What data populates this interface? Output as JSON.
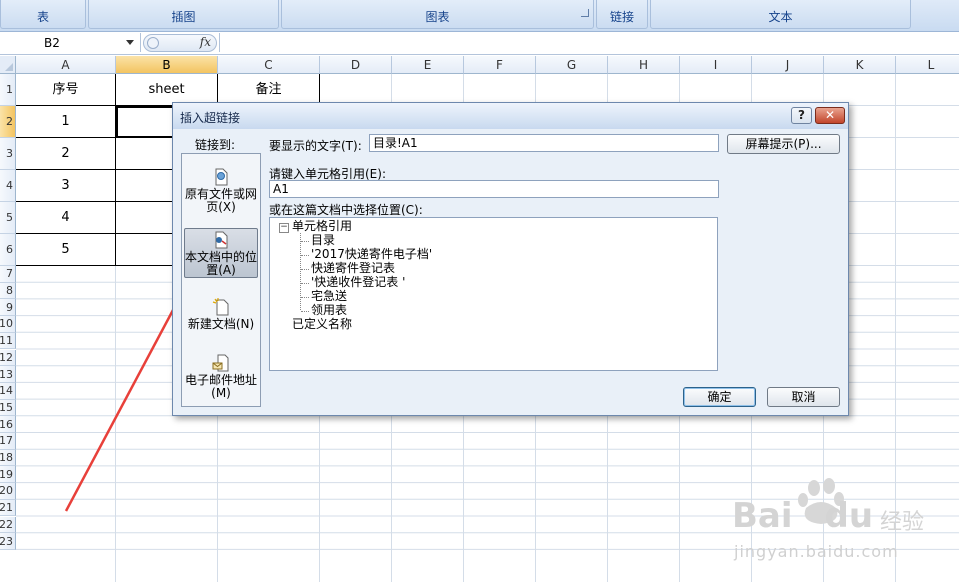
{
  "ribbon": {
    "groups": [
      "表",
      "插图",
      "图表",
      "链接",
      "文本"
    ]
  },
  "formula_bar": {
    "name_box": "B2",
    "fx_label": "fx",
    "formula": ""
  },
  "sheet": {
    "columns": [
      "A",
      "B",
      "C",
      "D",
      "E",
      "F",
      "G",
      "H",
      "I",
      "J",
      "K",
      "L"
    ],
    "selected_column": "B",
    "rows": [
      "1",
      "2",
      "3",
      "4",
      "5",
      "6",
      "7",
      "8",
      "9",
      "10",
      "11",
      "12",
      "13",
      "14",
      "15",
      "16",
      "17",
      "18",
      "19",
      "20",
      "21",
      "22",
      "23"
    ],
    "headers": [
      "序号",
      "sheet",
      "备注"
    ],
    "data_rows": [
      [
        "1",
        "",
        ""
      ],
      [
        "2",
        "",
        ""
      ],
      [
        "3",
        "",
        ""
      ],
      [
        "4",
        "",
        ""
      ],
      [
        "5",
        "",
        ""
      ]
    ]
  },
  "dialog": {
    "title": "插入超链接",
    "help_label": "?",
    "close_label": "✕",
    "link_to_label": "链接到:",
    "link_items": [
      {
        "label": "原有文件或网页(X)",
        "icon": "web-page-icon"
      },
      {
        "label": "本文档中的位置(A)",
        "icon": "document-place-icon"
      },
      {
        "label": "新建文档(N)",
        "icon": "new-document-icon"
      },
      {
        "label": "电子邮件地址(M)",
        "icon": "email-icon"
      }
    ],
    "display_text_label": "要显示的文字(T):",
    "display_text_value": "目录!A1",
    "screentip_button": "屏幕提示(P)...",
    "cell_ref_label": "请键入单元格引用(E):",
    "cell_ref_value": "A1",
    "place_label": "或在这篇文档中选择位置(C):",
    "tree": {
      "expander": "−",
      "root": "单元格引用",
      "children": [
        "目录",
        "'2017快递寄件电子档'",
        "快递寄件登记表",
        "'快递收件登记表 '",
        "宅急送",
        "领用表"
      ],
      "defined_names": "已定义名称"
    },
    "ok_button": "确定",
    "cancel_button": "取消"
  },
  "watermark": {
    "brand": "Bai",
    "brand2": "du",
    "tagline": "经验",
    "url": "jingyan.baidu.com"
  },
  "colors": {
    "arrow": "#e8403a",
    "accent": "#15428b"
  }
}
